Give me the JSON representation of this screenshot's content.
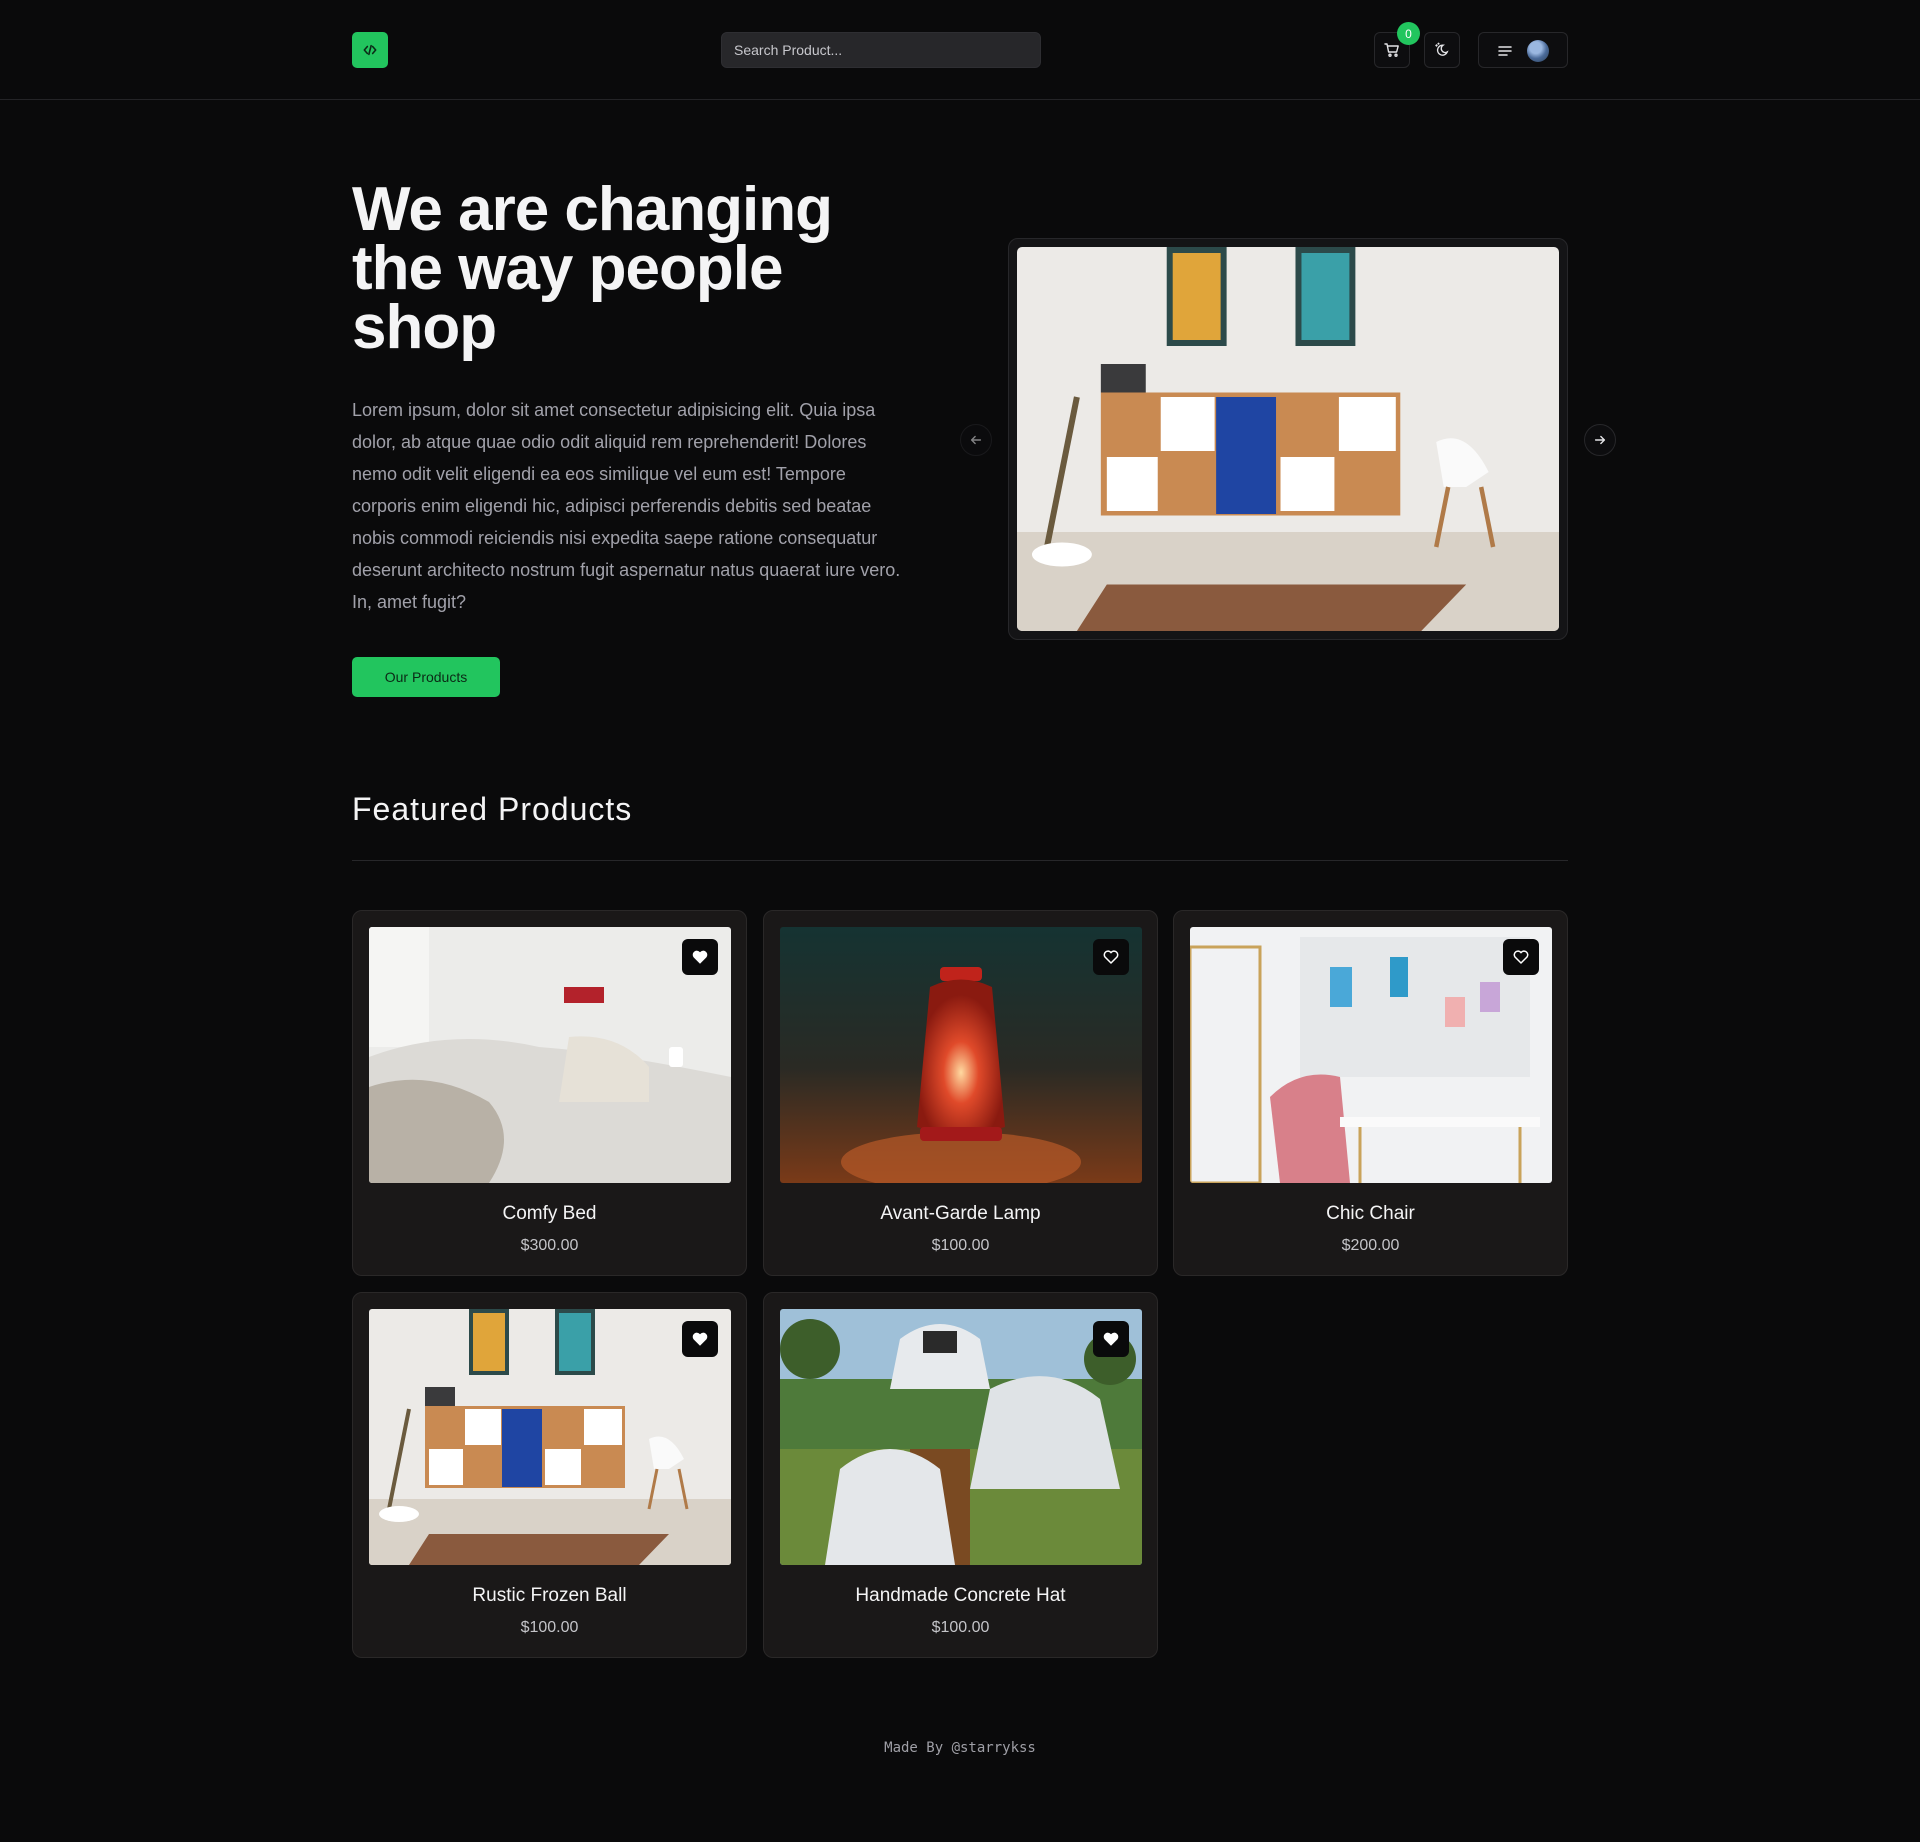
{
  "header": {
    "logo_icon": "code-icon",
    "accent_color": "#22c55e",
    "search_placeholder": "Search Product...",
    "cart_count": "0",
    "cart_icon": "cart-icon",
    "theme_icon": "theme-toggle-icon",
    "menu_icon": "hamburger-icon"
  },
  "hero": {
    "title": "We are changing the way people shop",
    "description": "Lorem ipsum, dolor sit amet consectetur adipisicing elit. Quia ipsa dolor, ab atque quae odio odit aliquid rem reprehenderit! Dolores nemo odit velit eligendi ea eos similique vel eum est! Tempore corporis enim eligendi hic, adipisci perferendis debitis sed beatae nobis commodi reiciendis nisi expedita saepe ratione consequatur deserunt architecto nostrum fugit aspernatur natus quaerat iure vero. In, amet fugit?",
    "cta_label": "Our Products"
  },
  "featured": {
    "title": "Featured Products",
    "products": [
      {
        "name": "Comfy Bed",
        "price": "$300.00",
        "favorited": true
      },
      {
        "name": "Avant-Garde Lamp",
        "price": "$100.00",
        "favorited": false
      },
      {
        "name": "Chic Chair",
        "price": "$200.00",
        "favorited": false
      },
      {
        "name": "Rustic Frozen Ball",
        "price": "$100.00",
        "favorited": true
      },
      {
        "name": "Handmade Concrete Hat",
        "price": "$100.00",
        "favorited": true
      }
    ]
  },
  "footer": {
    "text": "Made By @starrykss"
  }
}
